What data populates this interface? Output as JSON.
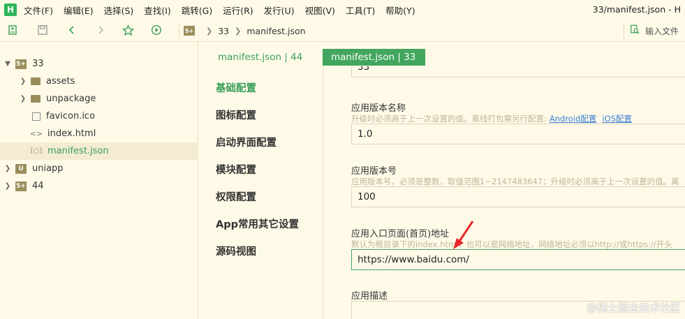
{
  "app": {
    "logo": "H",
    "window_title": "33/manifest.json - H"
  },
  "menu": [
    "文件(F)",
    "编辑(E)",
    "选择(S)",
    "查找(I)",
    "跳转(G)",
    "运行(R)",
    "发行(U)",
    "视图(V)",
    "工具(T)",
    "帮助(Y)"
  ],
  "toolbar": {
    "icons": [
      "new-file-icon",
      "save-icon",
      "back-icon",
      "forward-icon",
      "star-icon",
      "run-icon"
    ],
    "breadcrumb": {
      "badge": "5+",
      "project": "33",
      "file": "manifest.json"
    },
    "search_placeholder": "输入文件"
  },
  "tree": [
    {
      "label": "33",
      "icon": "project-icon",
      "badge": "5+",
      "expanded": true
    },
    {
      "label": "assets",
      "icon": "folder-icon"
    },
    {
      "label": "unpackage",
      "icon": "folder-icon"
    },
    {
      "label": "favicon.ico",
      "icon": "image-file-icon"
    },
    {
      "label": "index.html",
      "icon": "html-file-icon"
    },
    {
      "label": "manifest.json",
      "icon": "json-file-icon",
      "selected": true
    },
    {
      "label": "uniapp",
      "icon": "uniapp-project-icon",
      "badge": "U"
    },
    {
      "label": "44",
      "icon": "project-icon",
      "badge": "5+"
    }
  ],
  "tabs": [
    {
      "label": "manifest.json | 44",
      "active": false
    },
    {
      "label": "manifest.json | 33",
      "active": true
    }
  ],
  "settings_nav": [
    "基础配置",
    "图标配置",
    "启动界面配置",
    "模块配置",
    "权限配置",
    "App常用其它设置",
    "源码视图"
  ],
  "form": {
    "top_value": "33",
    "version_name": {
      "label": "应用版本名称",
      "hint": "升级时必须高于上一次设置的值。离线打包需另行配置:",
      "link_android": "Android配置",
      "link_ios": "iOS配置",
      "value": "1.0"
    },
    "version_code": {
      "label": "应用版本号",
      "hint": "应用版本号，必须是整数，取值范围1~2147483647；升级时必须高于上一次设置的值。离",
      "value": "100"
    },
    "entry_page": {
      "label": "应用入口页面(首页)地址",
      "hint": "默认为根目录下的index.html，也可以是网络地址，网络地址必须以http://或https://开头",
      "value": "https://www.baidu.com/"
    },
    "description": {
      "label": "应用描述",
      "value": ""
    }
  },
  "watermark": "@稀土掘金技术社区",
  "colors": {
    "accent": "#42a65e",
    "background": "#fffae8",
    "annotation_arrow": "#e8262b"
  }
}
